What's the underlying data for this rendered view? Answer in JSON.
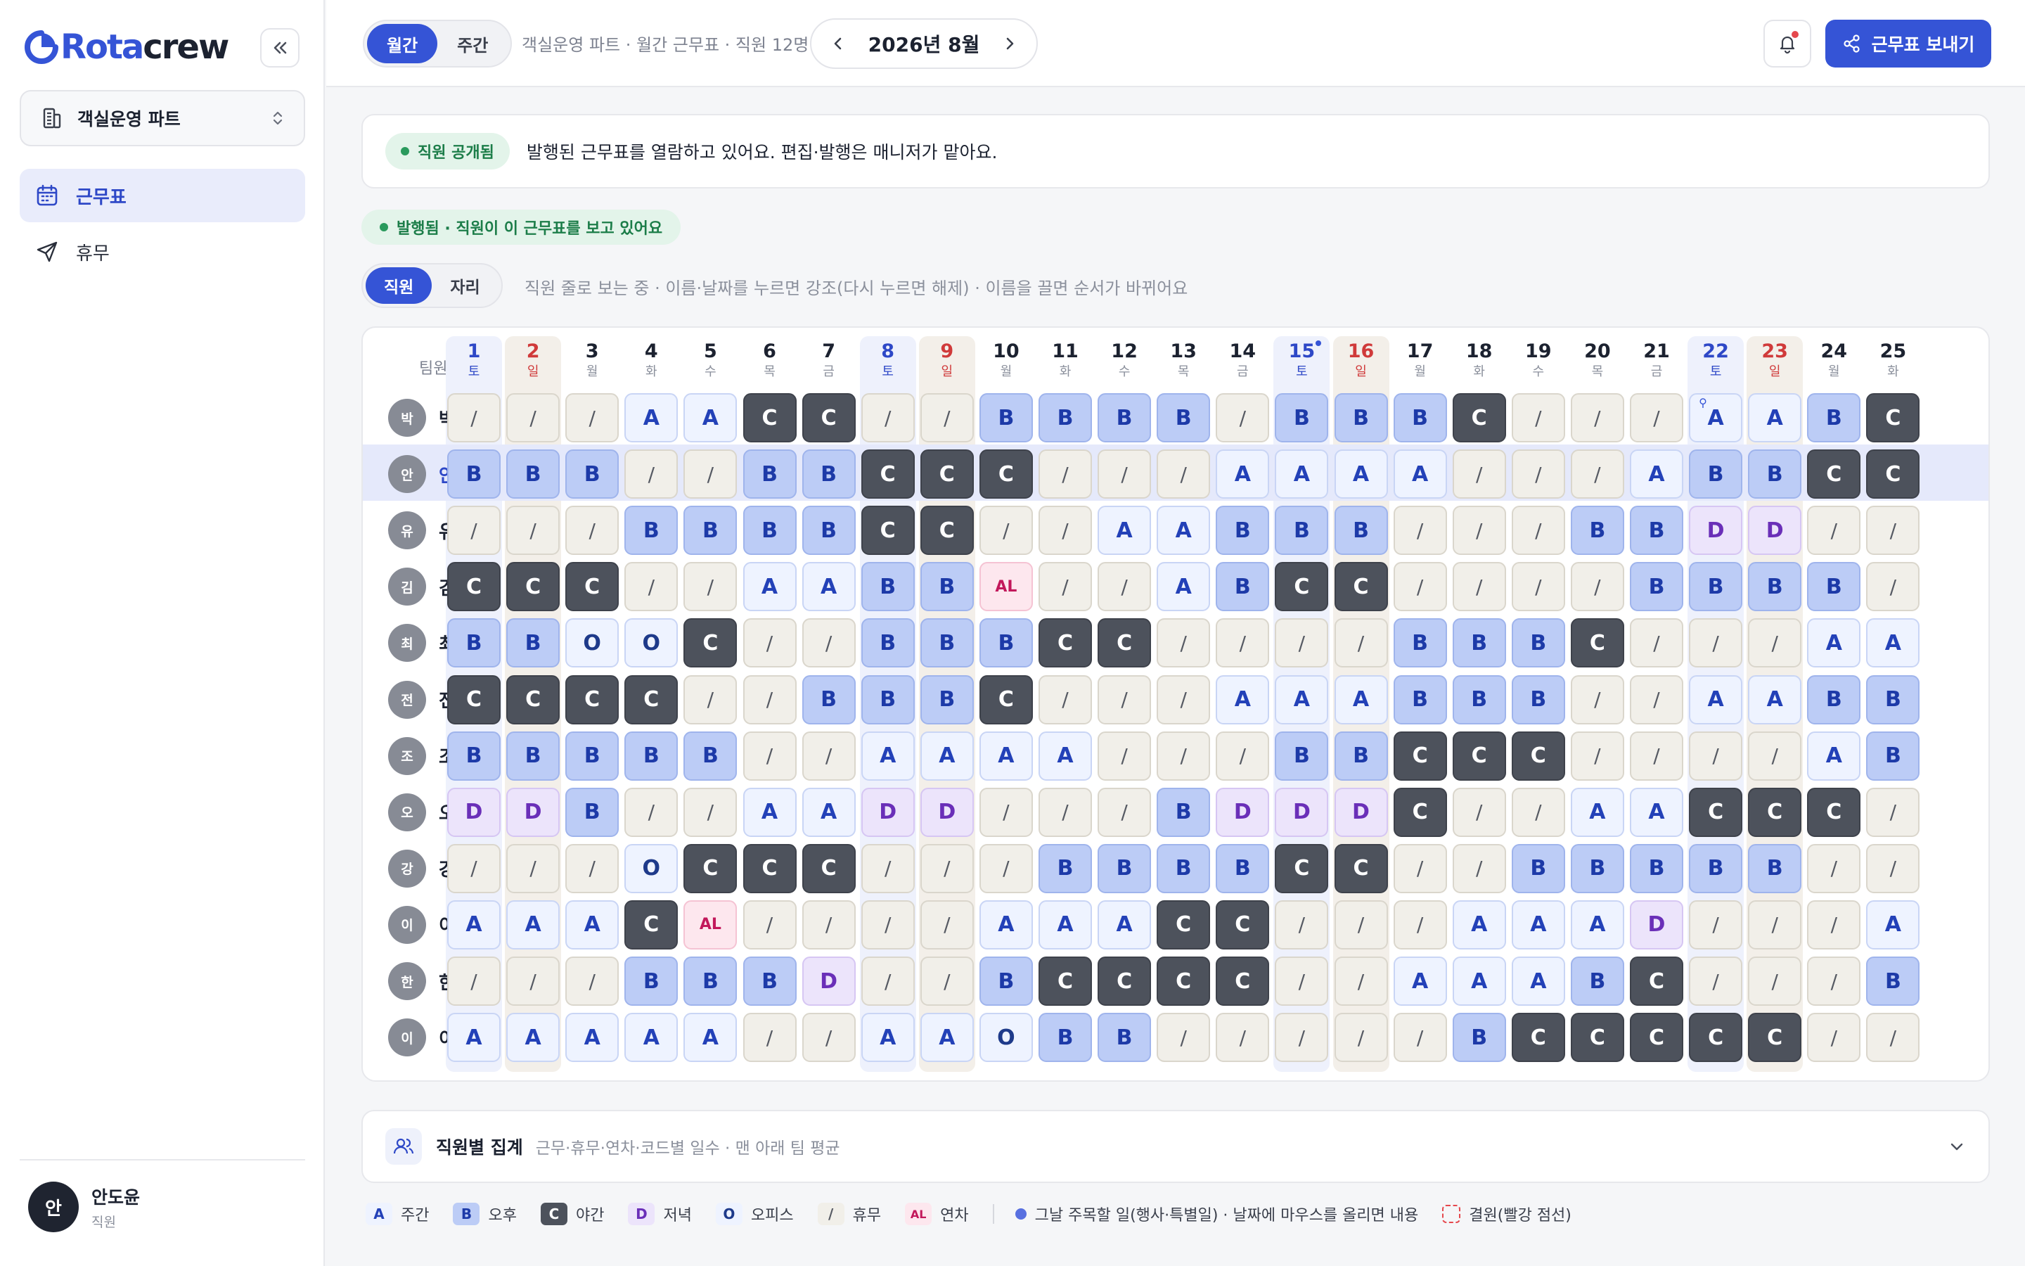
{
  "app": {
    "logo_prefix": "Rota",
    "logo_suffix": "crew"
  },
  "sidebar": {
    "team": "객실운영 파트",
    "nav": [
      {
        "label": "근무표",
        "icon": "calendar-icon",
        "active": true
      },
      {
        "label": "휴무",
        "icon": "send-icon",
        "active": false
      }
    ],
    "user": {
      "name": "안도윤",
      "role": "직원",
      "initial": "안"
    }
  },
  "topbar": {
    "view_monthly": "월간",
    "view_weekly": "주간",
    "subtitle": "객실운영 파트 · 월간 근무표 · 직원 12명",
    "month": "2026년 8월",
    "send_label": "근무표 보내기"
  },
  "notice": {
    "badge": "직원 공개됨",
    "message": "발행된 근무표를 열람하고 있어요. 편집·발행은 매니저가 맡아요."
  },
  "published": "발행됨 · 직원이 이 근무표를 보고 있어요",
  "view": {
    "by_staff": "직원",
    "by_seat": "자리",
    "hint": "직원 줄로 보는 중 · 이름·날짜를 누르면 강조(다시 누르면 해제) · 이름을 끌면 순서가 바뀌어요"
  },
  "roster": {
    "team_header": "팀원",
    "days": [
      {
        "d": "1",
        "w": "토",
        "k": "sat"
      },
      {
        "d": "2",
        "w": "일",
        "k": "sun"
      },
      {
        "d": "3",
        "w": "월",
        "k": "wd"
      },
      {
        "d": "4",
        "w": "화",
        "k": "wd"
      },
      {
        "d": "5",
        "w": "수",
        "k": "wd"
      },
      {
        "d": "6",
        "w": "목",
        "k": "wd"
      },
      {
        "d": "7",
        "w": "금",
        "k": "wd"
      },
      {
        "d": "8",
        "w": "토",
        "k": "sat"
      },
      {
        "d": "9",
        "w": "일",
        "k": "sun"
      },
      {
        "d": "10",
        "w": "월",
        "k": "wd"
      },
      {
        "d": "11",
        "w": "화",
        "k": "wd"
      },
      {
        "d": "12",
        "w": "수",
        "k": "wd"
      },
      {
        "d": "13",
        "w": "목",
        "k": "wd"
      },
      {
        "d": "14",
        "w": "금",
        "k": "wd"
      },
      {
        "d": "15",
        "w": "토",
        "k": "sat",
        "event": true
      },
      {
        "d": "16",
        "w": "일",
        "k": "sun"
      },
      {
        "d": "17",
        "w": "월",
        "k": "wd"
      },
      {
        "d": "18",
        "w": "화",
        "k": "wd"
      },
      {
        "d": "19",
        "w": "수",
        "k": "wd"
      },
      {
        "d": "20",
        "w": "목",
        "k": "wd"
      },
      {
        "d": "21",
        "w": "금",
        "k": "wd"
      },
      {
        "d": "22",
        "w": "토",
        "k": "sat"
      },
      {
        "d": "23",
        "w": "일",
        "k": "sun"
      },
      {
        "d": "24",
        "w": "월",
        "k": "wd"
      },
      {
        "d": "25",
        "w": "화",
        "k": "wd"
      }
    ],
    "employees": [
      {
        "initial": "박",
        "name": "박현우",
        "shifts": [
          "/",
          "/",
          "/",
          "A",
          "A",
          "C",
          "C",
          "/",
          "/",
          "B",
          "B",
          "B",
          "B",
          "/",
          "B",
          "B",
          "B",
          "C",
          "/",
          "/",
          "/",
          "A*",
          "A",
          "B",
          "C"
        ]
      },
      {
        "initial": "안",
        "name": "안도윤",
        "me": true,
        "shifts": [
          "B",
          "B",
          "B",
          "/",
          "/",
          "B",
          "B",
          "C",
          "C",
          "C",
          "/",
          "/",
          "/",
          "A",
          "A",
          "A",
          "A",
          "/",
          "/",
          "/",
          "A",
          "B",
          "B",
          "C",
          "C"
        ]
      },
      {
        "initial": "유",
        "name": "유준호",
        "shifts": [
          "/",
          "/",
          "/",
          "B",
          "B",
          "B",
          "B",
          "C",
          "C",
          "/",
          "/",
          "A",
          "A",
          "B",
          "B",
          "B",
          "/",
          "/",
          "/",
          "B",
          "B",
          "D",
          "D",
          "/",
          "/"
        ]
      },
      {
        "initial": "김",
        "name": "김민준",
        "shifts": [
          "C",
          "C",
          "C",
          "/",
          "/",
          "A",
          "A",
          "B",
          "B",
          "AL",
          "/",
          "/",
          "A",
          "B",
          "C",
          "C",
          "/",
          "/",
          "/",
          "/",
          "B",
          "B",
          "B",
          "B",
          "/"
        ]
      },
      {
        "initial": "최",
        "name": "최수아",
        "shifts": [
          "B",
          "B",
          "O",
          "O",
          "C",
          "/",
          "/",
          "B",
          "B",
          "B",
          "C",
          "C",
          "/",
          "/",
          "/",
          "/",
          "B",
          "B",
          "B",
          "C",
          "/",
          "/",
          "/",
          "A",
          "A"
        ]
      },
      {
        "initial": "전",
        "name": "전민재",
        "shifts": [
          "C",
          "C",
          "C",
          "C",
          "/",
          "/",
          "B",
          "B",
          "B",
          "C",
          "/",
          "/",
          "/",
          "A",
          "A",
          "A",
          "B",
          "B",
          "B",
          "/",
          "/",
          "A",
          "A",
          "B",
          "B"
        ]
      },
      {
        "initial": "조",
        "name": "조성민",
        "shifts": [
          "B",
          "B",
          "B",
          "B",
          "B",
          "/",
          "/",
          "A",
          "A",
          "A",
          "A",
          "/",
          "/",
          "/",
          "B",
          "B",
          "C",
          "C",
          "C",
          "/",
          "/",
          "/",
          "/",
          "A",
          "B"
        ]
      },
      {
        "initial": "오",
        "name": "오유진",
        "shifts": [
          "D",
          "D",
          "B",
          "/",
          "/",
          "A",
          "A",
          "D",
          "D",
          "/",
          "/",
          "/",
          "B",
          "D",
          "D",
          "D",
          "C",
          "/",
          "/",
          "A",
          "A",
          "C",
          "C",
          "C",
          "/"
        ]
      },
      {
        "initial": "강",
        "name": "강하윤",
        "shifts": [
          "/",
          "/",
          "/",
          "O",
          "C",
          "C",
          "C",
          "/",
          "/",
          "/",
          "B",
          "B",
          "B",
          "B",
          "C",
          "C",
          "/",
          "/",
          "B",
          "B",
          "B",
          "B",
          "B",
          "/",
          "/"
        ]
      },
      {
        "initial": "이",
        "name": "이준서",
        "shifts": [
          "A",
          "A",
          "A",
          "C",
          "AL",
          "/",
          "/",
          "/",
          "/",
          "A",
          "A",
          "A",
          "C",
          "C",
          "/",
          "/",
          "/",
          "A",
          "A",
          "A",
          "D",
          "/",
          "/",
          "/",
          "A"
        ]
      },
      {
        "initial": "한",
        "name": "한지우",
        "shifts": [
          "/",
          "/",
          "/",
          "B",
          "B",
          "B",
          "D",
          "/",
          "/",
          "B",
          "C",
          "C",
          "C",
          "C",
          "/",
          "/",
          "A",
          "A",
          "A",
          "B",
          "C",
          "/",
          "/",
          "/",
          "B"
        ]
      },
      {
        "initial": "이",
        "name": "이서연",
        "shifts": [
          "A",
          "A",
          "A",
          "A",
          "A",
          "/",
          "/",
          "A",
          "A",
          "O",
          "B",
          "B",
          "/",
          "/",
          "/",
          "/",
          "/",
          "B",
          "C",
          "C",
          "C",
          "C",
          "C",
          "/",
          "/"
        ]
      }
    ]
  },
  "summary": {
    "title": "직원별 집계",
    "subtitle": "근무·휴무·연차·코드별 일수 · 맨 아래 팀 평균"
  },
  "legend": [
    {
      "code": "A",
      "label": "주간"
    },
    {
      "code": "B",
      "label": "오후"
    },
    {
      "code": "C",
      "label": "야간"
    },
    {
      "code": "D",
      "label": "저녁"
    },
    {
      "code": "O",
      "label": "오피스"
    },
    {
      "code": "/",
      "label": "휴무"
    },
    {
      "code": "AL",
      "label": "연차"
    }
  ],
  "legend_notes": {
    "event": "그날 주목할 일(행사·특별일) · 날짜에 마우스를 올리면 내용",
    "vacancy": "결원(빨강 점선)"
  },
  "colors": {
    "accent": "#3554d6",
    "sat": "#2e48c7",
    "sun": "#d03a3a",
    "night": "#4d525c",
    "published": "#1c7d49"
  }
}
